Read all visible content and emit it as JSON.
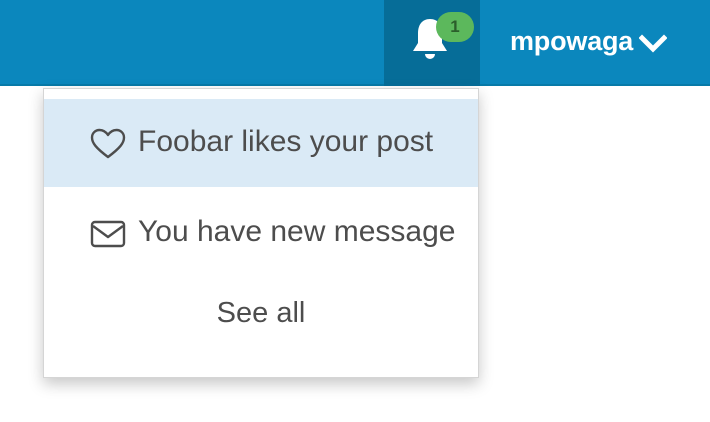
{
  "navbar": {
    "bell_icon": "bell-icon",
    "notification_count": "1",
    "username": "mpowaga",
    "user_menu_icon": "chevron-down-icon",
    "colors": {
      "navbar_bg": "#0b87bd",
      "active_toggle_bg": "#066d98",
      "badge_bg": "#5cb85c"
    }
  },
  "notifications": {
    "items": [
      {
        "icon": "heart-icon",
        "label": "Foobar likes your post",
        "highlighted": true
      },
      {
        "icon": "envelope-icon",
        "label": "You have new message",
        "highlighted": false
      }
    ],
    "see_all_label": "See all"
  }
}
